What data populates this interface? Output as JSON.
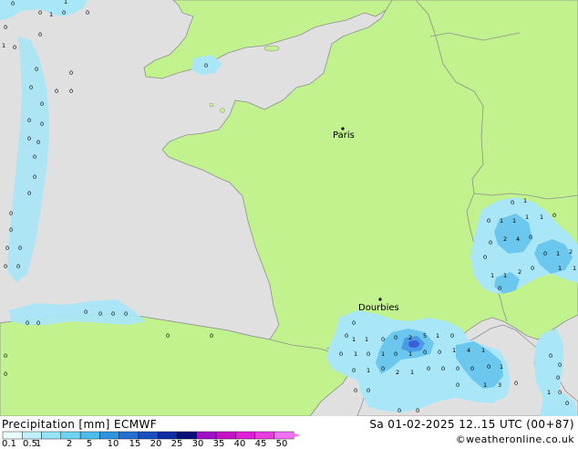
{
  "map": {
    "cities": [
      {
        "name": "Paris"
      },
      {
        "name": "Dourbies"
      }
    ],
    "colors": {
      "sea": "#e0e0e0",
      "land": "#c1f28e",
      "border": "#909090",
      "coast": "#909090",
      "precip_light": "#a9e6f7",
      "precip_mid": "#6cc7ef",
      "precip_heavy": "#4a9ae6",
      "precip_max": "#3c5fd9"
    }
  },
  "footer": {
    "title": "Precipitation [mm]",
    "model": "ECMWF",
    "datetime": "Sa 01-02-2025 12..15 UTC (00+87)",
    "credit": "©weatheronline.co.uk",
    "scale_labels": [
      "0.1",
      "0.5",
      "1",
      "2",
      "5",
      "10",
      "15",
      "20",
      "25",
      "30",
      "35",
      "40",
      "45",
      "50"
    ],
    "scale_colors": [
      "#e8fbfd",
      "#bff0fb",
      "#96e3f7",
      "#6fd3f2",
      "#4bbdec",
      "#2f93e0",
      "#2470d2",
      "#1a4ec2",
      "#102ba6",
      "#060f7a",
      "#a010c8",
      "#c810c8",
      "#e020d8",
      "#e83ce0",
      "#f070f0"
    ]
  }
}
